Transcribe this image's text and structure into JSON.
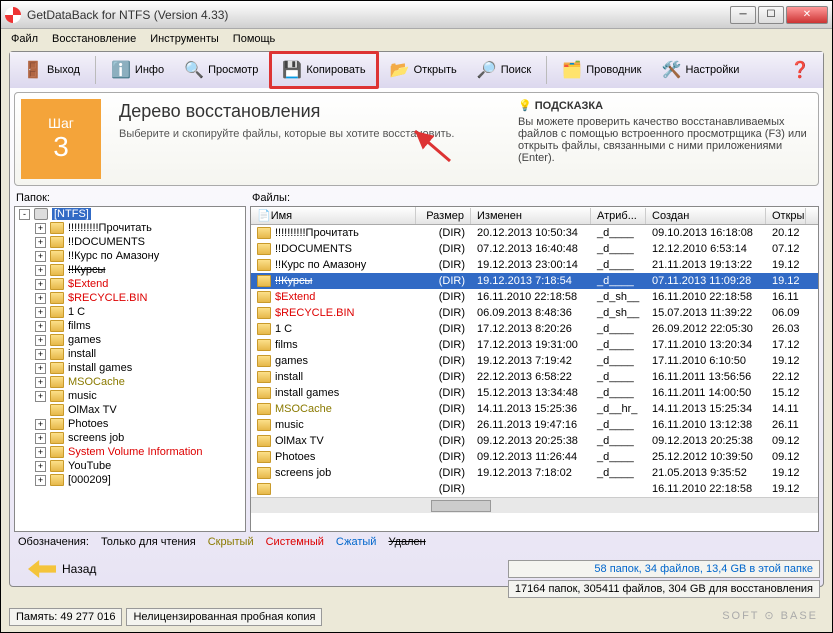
{
  "window": {
    "title": "GetDataBack for NTFS (Version 4.33)"
  },
  "menu": {
    "file": "Файл",
    "recovery": "Восстановление",
    "tools": "Инструменты",
    "help": "Помощь"
  },
  "toolbar": {
    "exit": "Выход",
    "info": "Инфо",
    "view": "Просмотр",
    "copy": "Копировать",
    "open": "Открыть",
    "search": "Поиск",
    "explorer": "Проводник",
    "settings": "Настройки"
  },
  "step": {
    "label": "Шаг",
    "num": "3"
  },
  "heading": "Дерево восстановления",
  "subheading": "Выберите и скопируйте файлы, которые вы хотите восстановить.",
  "hint": {
    "title": "ПОДСКАЗКА",
    "text": "Вы можете проверить качество восстанавливаемых файлов с помощью встроенного просмотрщика (F3) или открыть файлы, связанными с ними приложениями (Enter)."
  },
  "labels": {
    "folders": "Папок:",
    "files": "Файлы:"
  },
  "columns": {
    "name": "Имя",
    "size": "Размер",
    "modified": "Изменен",
    "attr": "Атриб...",
    "created": "Создан",
    "opened": "Откры"
  },
  "tree": [
    {
      "label": "[NTFS]",
      "icon": "disk",
      "selected": true,
      "depth": 0,
      "exp": "-"
    },
    {
      "label": "!!!!!!!!!!Прочитать",
      "depth": 1,
      "exp": "+"
    },
    {
      "label": "!!DOCUMENTS",
      "depth": 1,
      "exp": "+"
    },
    {
      "label": "!!Курс по Амазону",
      "depth": 1,
      "exp": "+"
    },
    {
      "label": "!!Курсы",
      "depth": 1,
      "exp": "+",
      "cls": "strike"
    },
    {
      "label": "$Extend",
      "depth": 1,
      "exp": "+",
      "cls": "red"
    },
    {
      "label": "$RECYCLE.BIN",
      "depth": 1,
      "exp": "+",
      "cls": "red"
    },
    {
      "label": "1 C",
      "depth": 1,
      "exp": "+"
    },
    {
      "label": "films",
      "depth": 1,
      "exp": "+"
    },
    {
      "label": "games",
      "depth": 1,
      "exp": "+"
    },
    {
      "label": "install",
      "depth": 1,
      "exp": "+"
    },
    {
      "label": "install games",
      "depth": 1,
      "exp": "+"
    },
    {
      "label": "MSOCache",
      "depth": 1,
      "exp": "+",
      "cls": "olive"
    },
    {
      "label": "music",
      "depth": 1,
      "exp": "+"
    },
    {
      "label": "OlMax TV",
      "depth": 1,
      "exp": ""
    },
    {
      "label": "Photoes",
      "depth": 1,
      "exp": "+"
    },
    {
      "label": "screens job",
      "depth": 1,
      "exp": "+"
    },
    {
      "label": "System Volume Information",
      "depth": 1,
      "exp": "+",
      "cls": "red"
    },
    {
      "label": "YouTube",
      "depth": 1,
      "exp": "+"
    },
    {
      "label": "[000209]",
      "depth": 1,
      "exp": "+"
    }
  ],
  "files": [
    {
      "name": "!!!!!!!!!!Прочитать",
      "size": "(DIR)",
      "mod": "20.12.2013 10:50:34",
      "attr": "_d____",
      "created": "09.10.2013 16:18:08",
      "open": "20.12"
    },
    {
      "name": "!!DOCUMENTS",
      "size": "(DIR)",
      "mod": "07.12.2013 16:40:48",
      "attr": "_d____",
      "created": "12.12.2010 6:53:14",
      "open": "07.12"
    },
    {
      "name": "!!Курс по Амазону",
      "size": "(DIR)",
      "mod": "19.12.2013 23:00:14",
      "attr": "_d____",
      "created": "21.11.2013 19:13:22",
      "open": "19.12"
    },
    {
      "name": "!!Курсы",
      "size": "(DIR)",
      "mod": "19.12.2013 7:18:54",
      "attr": "_d____",
      "created": "07.11.2013 11:09:28",
      "open": "19.12",
      "cls": "strike",
      "selected": true
    },
    {
      "name": "$Extend",
      "size": "(DIR)",
      "mod": "16.11.2010 22:18:58",
      "attr": "_d_sh__",
      "created": "16.11.2010 22:18:58",
      "open": "16.11",
      "cls": "red"
    },
    {
      "name": "$RECYCLE.BIN",
      "size": "(DIR)",
      "mod": "06.09.2013 8:48:36",
      "attr": "_d_sh__",
      "created": "15.07.2013 11:39:22",
      "open": "06.09",
      "cls": "red"
    },
    {
      "name": "1 C",
      "size": "(DIR)",
      "mod": "17.12.2013 8:20:26",
      "attr": "_d____",
      "created": "26.09.2012 22:05:30",
      "open": "26.03"
    },
    {
      "name": "films",
      "size": "(DIR)",
      "mod": "17.12.2013 19:31:00",
      "attr": "_d____",
      "created": "17.11.2010 13:20:34",
      "open": "17.12"
    },
    {
      "name": "games",
      "size": "(DIR)",
      "mod": "19.12.2013 7:19:42",
      "attr": "_d____",
      "created": "17.11.2010 6:10:50",
      "open": "19.12"
    },
    {
      "name": "install",
      "size": "(DIR)",
      "mod": "22.12.2013 6:58:22",
      "attr": "_d____",
      "created": "16.11.2011 13:56:56",
      "open": "22.12"
    },
    {
      "name": "install games",
      "size": "(DIR)",
      "mod": "15.12.2013 13:34:48",
      "attr": "_d____",
      "created": "16.11.2011 14:00:50",
      "open": "15.12"
    },
    {
      "name": "MSOCache",
      "size": "(DIR)",
      "mod": "14.11.2013 15:25:36",
      "attr": "_d__hr_",
      "created": "14.11.2013 15:25:34",
      "open": "14.11",
      "cls": "olive"
    },
    {
      "name": "music",
      "size": "(DIR)",
      "mod": "26.11.2013 19:47:16",
      "attr": "_d____",
      "created": "16.11.2010 13:12:38",
      "open": "26.11"
    },
    {
      "name": "OlMax TV",
      "size": "(DIR)",
      "mod": "09.12.2013 20:25:38",
      "attr": "_d____",
      "created": "09.12.2013 20:25:38",
      "open": "09.12"
    },
    {
      "name": "Photoes",
      "size": "(DIR)",
      "mod": "09.12.2013 11:26:44",
      "attr": "_d____",
      "created": "25.12.2012 10:39:50",
      "open": "09.12"
    },
    {
      "name": "screens job",
      "size": "(DIR)",
      "mod": "19.12.2013 7:18:02",
      "attr": "_d____",
      "created": "21.05.2013 9:35:52",
      "open": "19.12"
    },
    {
      "name": "",
      "size": "(DIR)",
      "mod": "",
      "attr": "",
      "created": "16.11.2010 22:18:58",
      "open": "19.12",
      "cls": "red"
    }
  ],
  "legend": {
    "label": "Обозначения:",
    "readonly": "Только для чтения",
    "hidden": "Скрытый",
    "system": "Системный",
    "compressed": "Сжатый",
    "deleted": "Удален"
  },
  "status": {
    "folder_summary": "58 папок, 34 файлов, 13,4 GB в этой папке",
    "total_summary": "17164 папок, 305411 файлов, 304 GB для восстановления"
  },
  "back": "Назад",
  "bottom": {
    "memory": "Память: 49 277 016",
    "license": "Нелицензированная пробная копия"
  },
  "watermark": "SOFT ⊙ BASE"
}
